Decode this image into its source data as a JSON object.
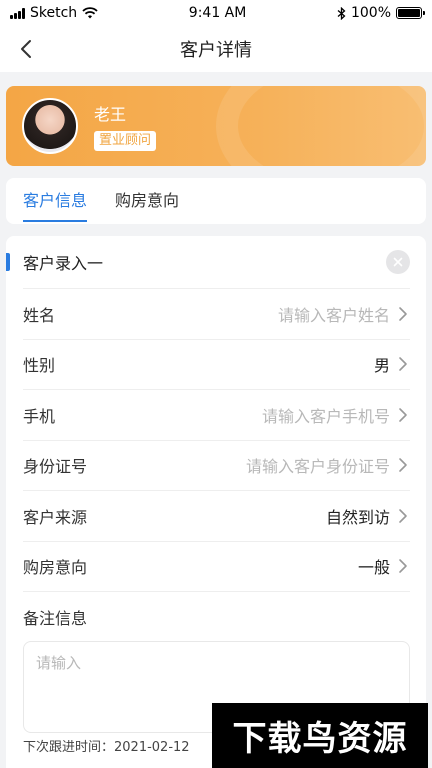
{
  "status_bar": {
    "carrier": "Sketch",
    "time": "9:41 AM",
    "battery": "100%"
  },
  "nav": {
    "title": "客户详情"
  },
  "profile": {
    "name": "老王",
    "role": "置业顾问"
  },
  "tabs": [
    {
      "label": "客户信息",
      "active": true
    },
    {
      "label": "购房意向",
      "active": false
    }
  ],
  "form": {
    "section_title": "客户录入一",
    "rows": [
      {
        "label": "姓名",
        "value": "请输入客户姓名",
        "placeholder": true
      },
      {
        "label": "性别",
        "value": "男",
        "placeholder": false
      },
      {
        "label": "手机",
        "value": "请输入客户手机号",
        "placeholder": true
      },
      {
        "label": "身份证号",
        "value": "请输入客户身份证号",
        "placeholder": true
      },
      {
        "label": "客户来源",
        "value": "自然到访",
        "placeholder": false
      },
      {
        "label": "购房意向",
        "value": "一般",
        "placeholder": false
      }
    ],
    "remarks_label": "备注信息",
    "remarks_placeholder": "请输入",
    "next_follow": "下次跟进时间：2021-02-12"
  },
  "watermark": "下载鸟资源",
  "colors": {
    "accent": "#2a7ce0",
    "card_orange": "#f4a645"
  }
}
